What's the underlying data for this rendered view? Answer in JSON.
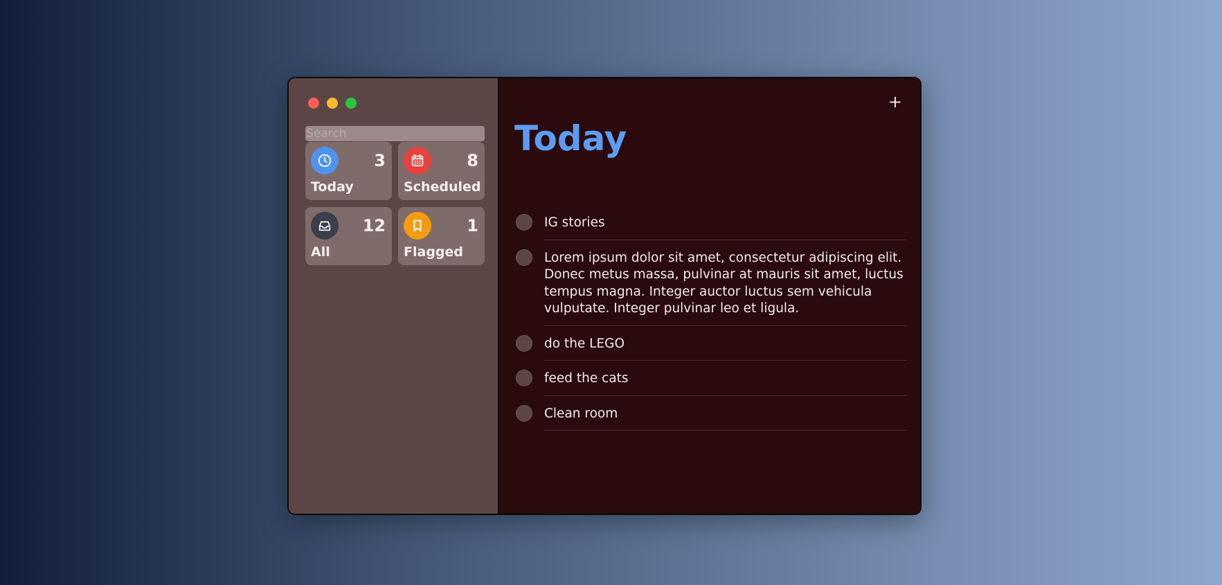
{
  "window": {
    "traffic_lights": [
      "close",
      "minimize",
      "maximize"
    ]
  },
  "sidebar": {
    "search": {
      "placeholder": "Search",
      "value": ""
    },
    "cards": [
      {
        "id": "today",
        "label": "Today",
        "count": "3",
        "icon": "clock-icon",
        "color": "#4f93f0"
      },
      {
        "id": "scheduled",
        "label": "Scheduled",
        "count": "8",
        "icon": "calendar-icon",
        "color": "#e8423f"
      },
      {
        "id": "all",
        "label": "All",
        "count": "12",
        "icon": "inbox-icon",
        "color": "#3b3f4d"
      },
      {
        "id": "flagged",
        "label": "Flagged",
        "count": "1",
        "icon": "bookmark-icon",
        "color": "#f39c12"
      }
    ]
  },
  "main": {
    "add_label": "+",
    "title": "Today",
    "title_color": "#5c9cf0",
    "tasks": [
      {
        "text": "IG stories",
        "completed": false
      },
      {
        "text": "Lorem ipsum dolor sit amet, consectetur adipiscing elit. Donec metus massa, pulvinar at mauris sit amet, luctus tempus magna. Integer auctor luctus sem vehicula vulputate. Integer pulvinar leo et ligula.",
        "completed": false
      },
      {
        "text": "do the LEGO",
        "completed": false
      },
      {
        "text": "feed the cats",
        "completed": false
      },
      {
        "text": "Clean room",
        "completed": false
      }
    ]
  }
}
